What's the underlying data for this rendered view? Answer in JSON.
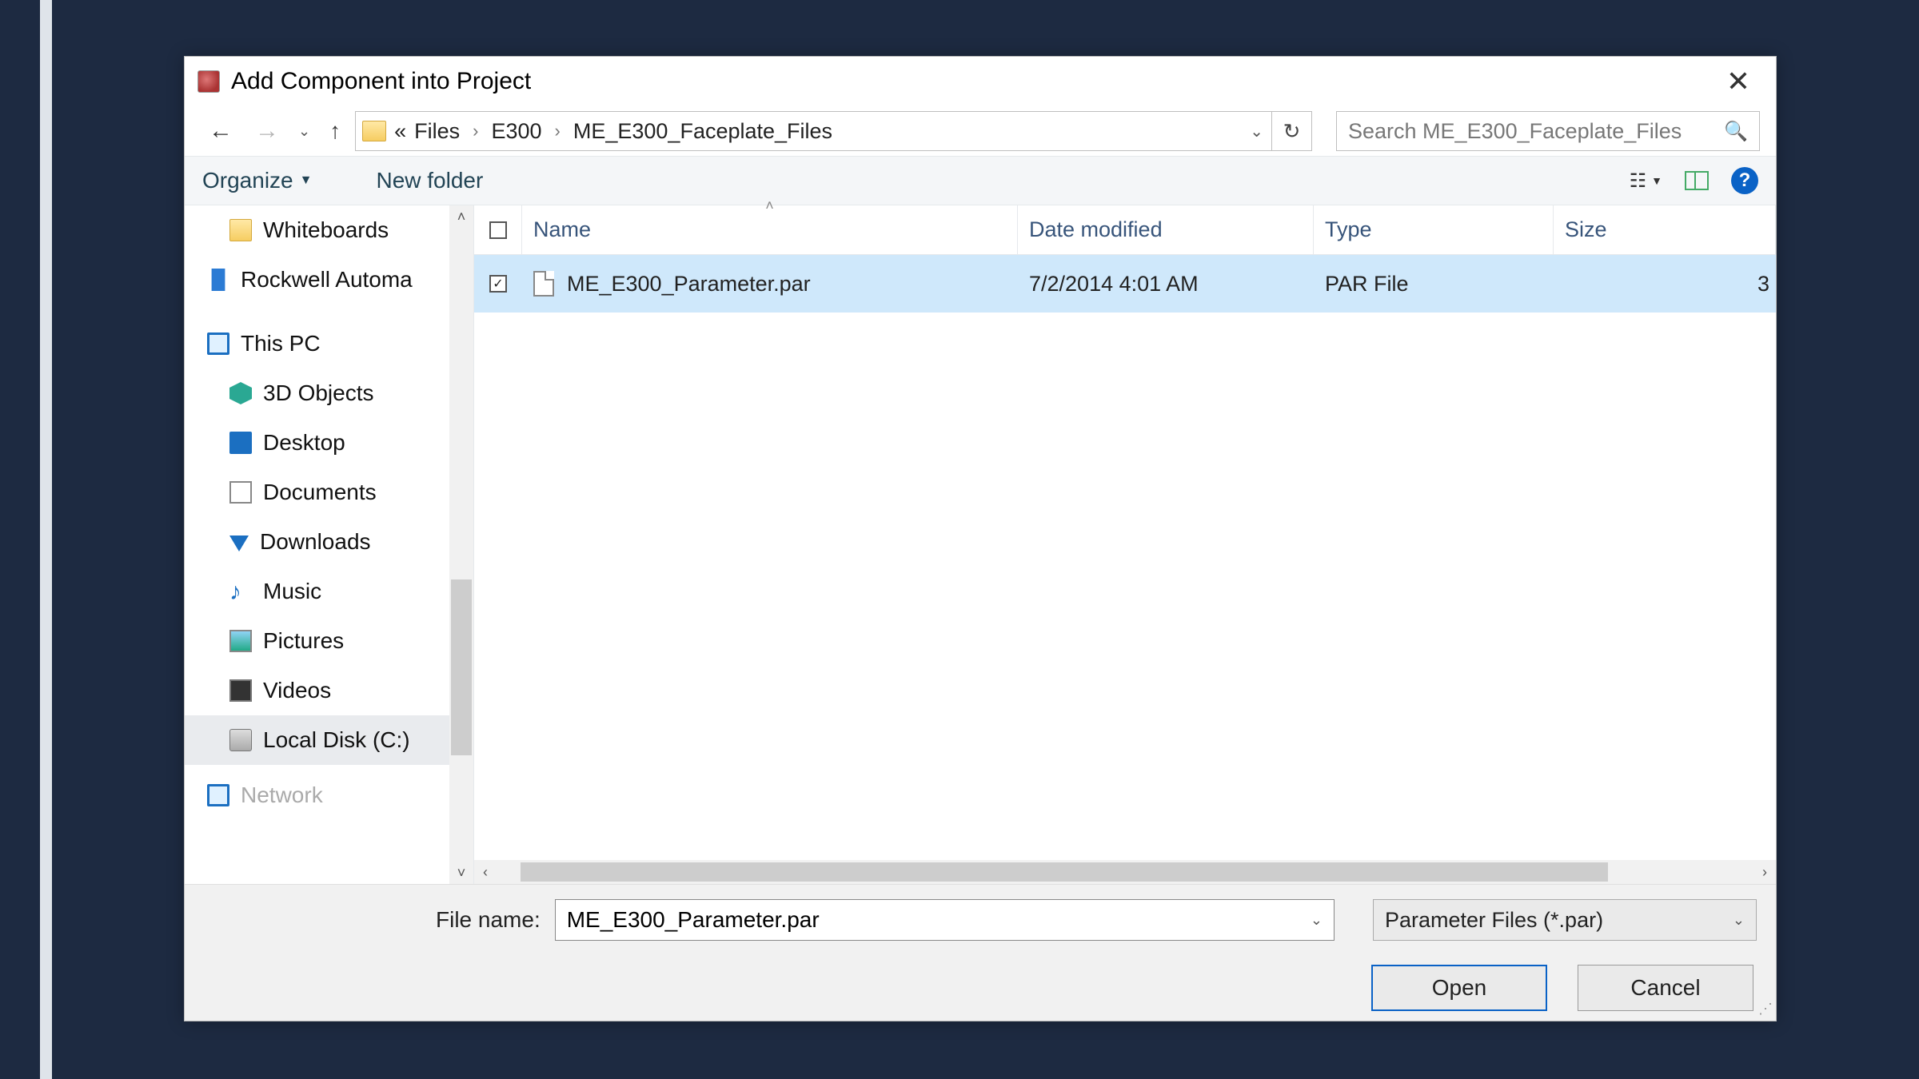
{
  "title": "Add Component into Project",
  "breadcrumbs": {
    "overflow": "«",
    "items": [
      "Files",
      "E300",
      "ME_E300_Faceplate_Files"
    ]
  },
  "search": {
    "placeholder": "Search ME_E300_Faceplate_Files"
  },
  "toolbar": {
    "organize": "Organize",
    "new_folder": "New folder"
  },
  "columns": {
    "name": "Name",
    "date": "Date modified",
    "type": "Type",
    "size": "Size"
  },
  "nav": {
    "items": [
      {
        "label": "Whiteboards",
        "icon": "folder",
        "indent": true
      },
      {
        "label": "Rockwell Automa",
        "icon": "building",
        "indent": false
      },
      {
        "label": "This PC",
        "icon": "monitor",
        "indent": false
      },
      {
        "label": "3D Objects",
        "icon": "cube",
        "indent": true
      },
      {
        "label": "Desktop",
        "icon": "desktop",
        "indent": true
      },
      {
        "label": "Documents",
        "icon": "doc",
        "indent": true
      },
      {
        "label": "Downloads",
        "icon": "dl",
        "indent": true
      },
      {
        "label": "Music",
        "icon": "note",
        "indent": true
      },
      {
        "label": "Pictures",
        "icon": "pic",
        "indent": true
      },
      {
        "label": "Videos",
        "icon": "vid",
        "indent": true
      },
      {
        "label": "Local Disk (C:)",
        "icon": "disk",
        "indent": true,
        "sel": true
      },
      {
        "label": "Network",
        "icon": "monitor",
        "indent": false,
        "cut": true
      }
    ]
  },
  "files": [
    {
      "name": "ME_E300_Parameter.par",
      "date": "7/2/2014 4:01 AM",
      "type": "PAR File",
      "size": "3",
      "checked": true,
      "selected": true
    }
  ],
  "filename": {
    "label": "File name:",
    "value": "ME_E300_Parameter.par"
  },
  "filetype": "Parameter Files (*.par)",
  "buttons": {
    "open": "Open",
    "cancel": "Cancel"
  }
}
